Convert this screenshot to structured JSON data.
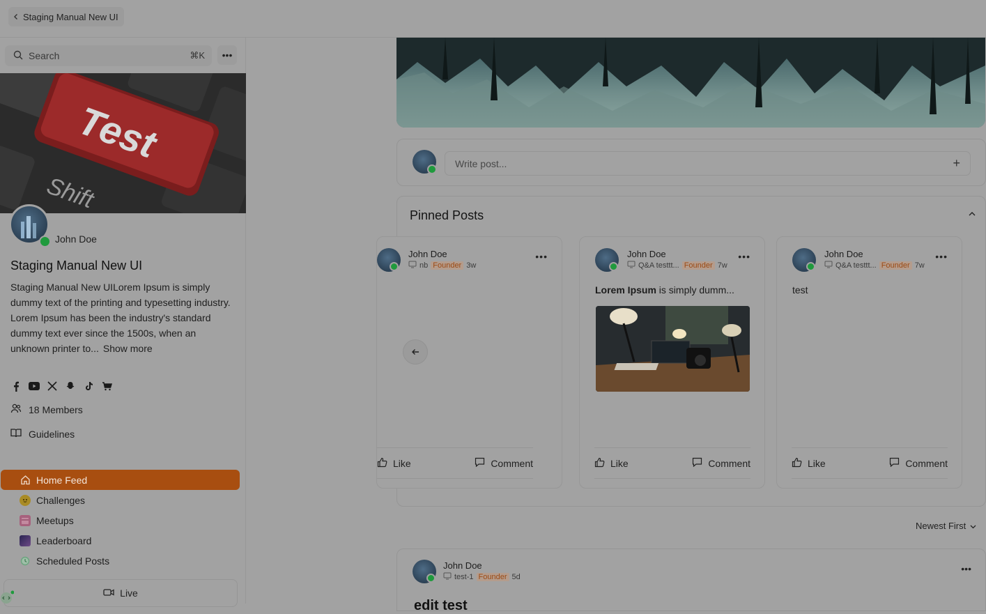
{
  "header": {
    "back_label": "Staging Manual New UI"
  },
  "sidebar": {
    "search_placeholder": "Search",
    "search_shortcut": "⌘K",
    "more_icon": "more-horizontal-icon",
    "banner_key_text": "Test",
    "banner_key_text2": "Shift",
    "owner_name": "John Doe",
    "community_title": "Staging Manual New UI",
    "description": "Staging Manual New UILorem Ipsum is simply dummy text of the printing and typesetting industry. Lorem Ipsum has been the industry's standard dummy text ever since the 1500s, when an unknown printer to...",
    "show_more": "Show more",
    "socials": [
      "facebook-icon",
      "youtube-icon",
      "x-icon",
      "snapchat-icon",
      "tiktok-icon",
      "shop-icon"
    ],
    "members": "18 Members",
    "guidelines": "Guidelines",
    "nav": [
      {
        "label": "Home Feed",
        "icon": "home-icon",
        "active": true
      },
      {
        "label": "Challenges",
        "icon": "emoji-icon"
      },
      {
        "label": "Meetups",
        "icon": "calendar-icon"
      },
      {
        "label": "Leaderboard",
        "icon": "leaderboard-icon"
      },
      {
        "label": "Scheduled Posts",
        "icon": "clock-icon"
      }
    ],
    "live_label": "Live"
  },
  "composer": {
    "placeholder": "Write post...",
    "add": "+"
  },
  "pinned": {
    "title": "Pinned Posts",
    "cards": [
      {
        "author": "John Doe",
        "channel": "nb",
        "badge": "Founder",
        "time": "3w",
        "text": "",
        "like": "Like",
        "comment": "Comment"
      },
      {
        "author": "John Doe",
        "channel": "Q&A testtt...",
        "badge": "Founder",
        "time": "7w",
        "text_bold": "Lorem Ipsum",
        "text": " is simply dumm...",
        "like": "Like",
        "comment": "Comment"
      },
      {
        "author": "John Doe",
        "channel": "Q&A testtt...",
        "badge": "Founder",
        "time": "7w",
        "text": "test",
        "like": "Like",
        "comment": "Comment"
      }
    ]
  },
  "sort": {
    "label": "Newest First"
  },
  "post": {
    "author": "John Doe",
    "channel": "test-1",
    "badge": "Founder",
    "time": "5d",
    "title": "edit test"
  },
  "colors": {
    "accent": "#a84e10",
    "online": "#1f9a3d",
    "overlay_bg": "#a2a2a2"
  }
}
